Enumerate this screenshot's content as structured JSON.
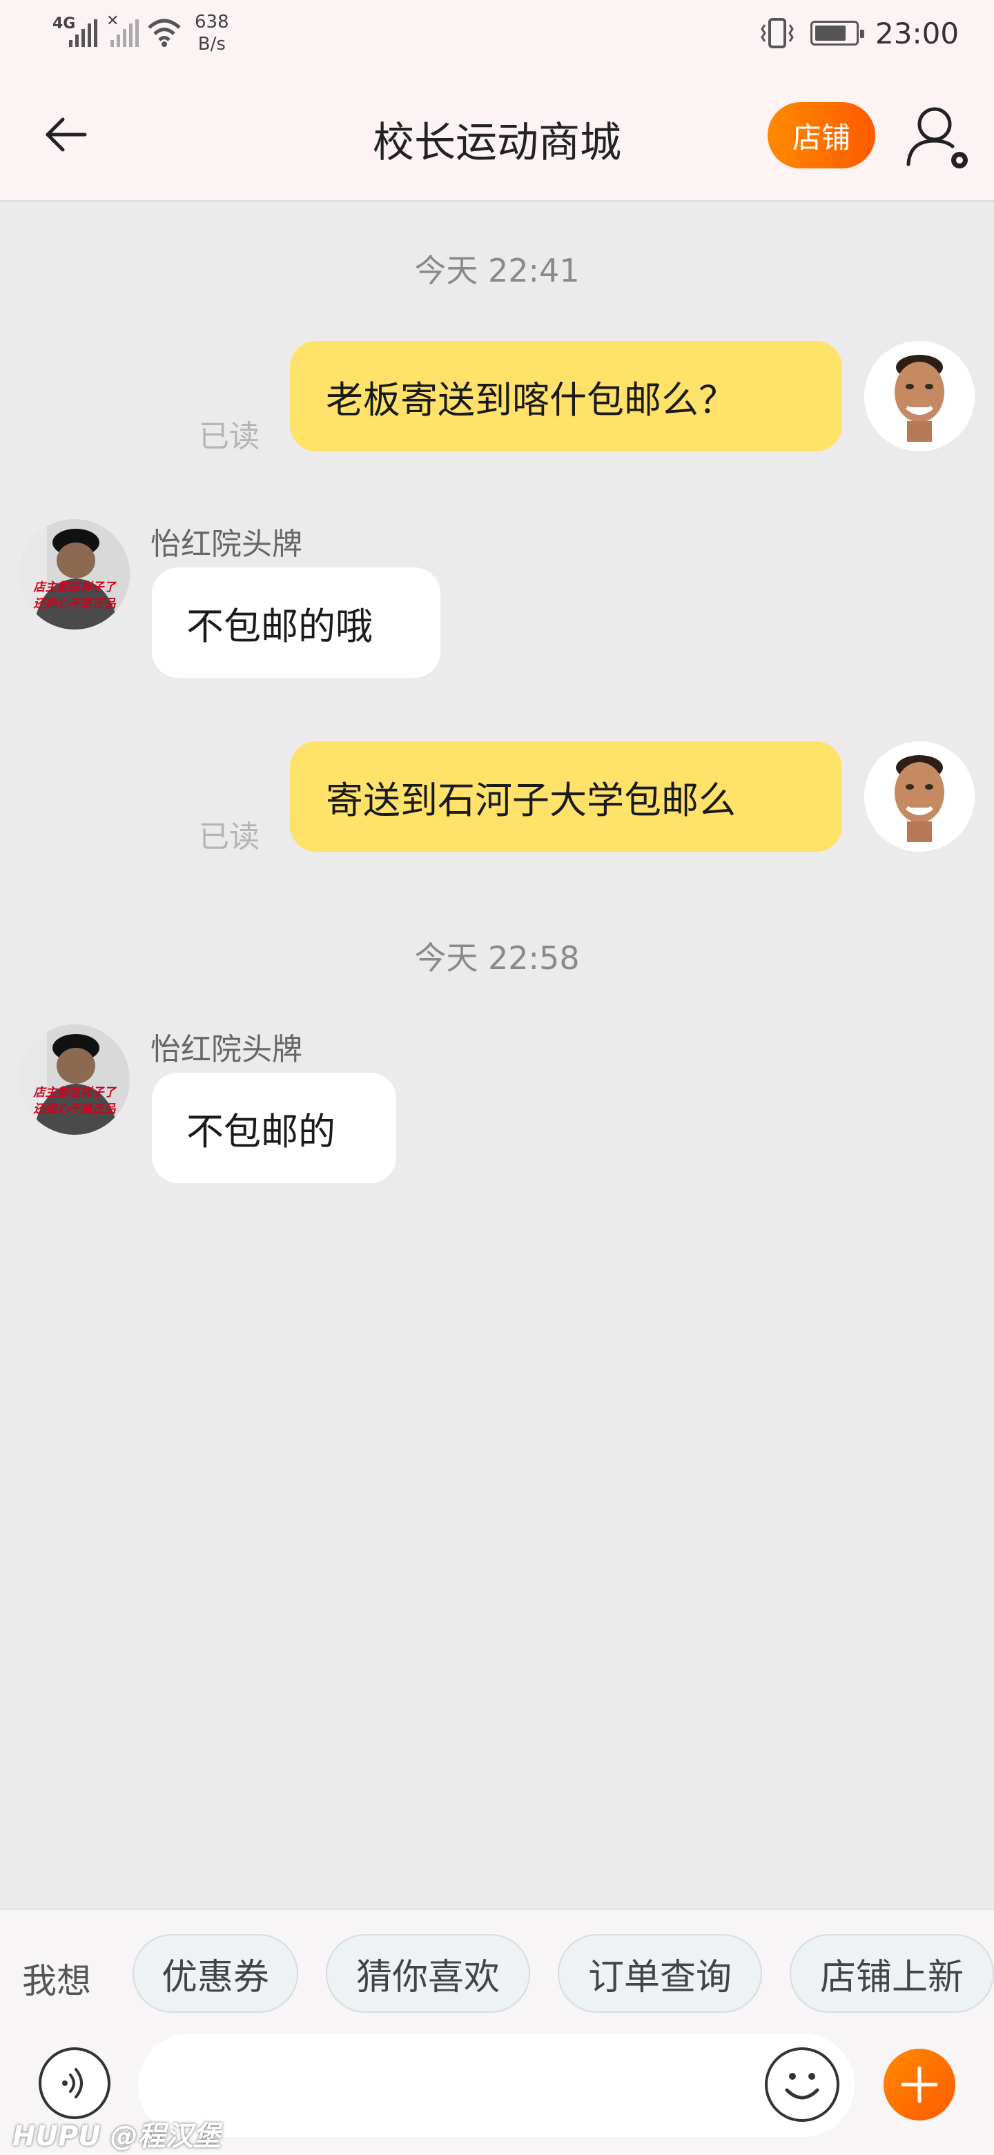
{
  "status_bar": {
    "network_label": "4G",
    "speed_value": "638",
    "speed_unit": "B/s",
    "time": "23:00",
    "battery_level": 0.75,
    "icons": [
      "cellular-signal-icon",
      "no-signal-icon",
      "wifi-icon",
      "vibrate-icon",
      "battery-icon"
    ]
  },
  "header": {
    "title": "校长运动商城",
    "shop_button": "店铺",
    "back_icon": "back-arrow-icon",
    "user_icon": "user-settings-icon"
  },
  "chat": {
    "messages": [
      {
        "type": "timestamp",
        "text": "今天  22:41"
      },
      {
        "type": "outgoing",
        "text": "老板寄送到喀什包邮么？",
        "status": "已读"
      },
      {
        "type": "incoming",
        "sender": "怡红院头牌",
        "text": "不包邮的哦"
      },
      {
        "type": "outgoing",
        "text": "寄送到石河子大学包邮么",
        "status": "已读"
      },
      {
        "type": "timestamp",
        "text": "今天  22:58"
      },
      {
        "type": "incoming",
        "sender": "怡红院头牌",
        "text": "不包邮的"
      }
    ]
  },
  "quick_actions": {
    "label": "我想",
    "chips": [
      "优惠券",
      "猜你喜欢",
      "订单查询",
      "店铺上新"
    ]
  },
  "input": {
    "placeholder": "",
    "value": ""
  },
  "watermark": "HUPU @程汉堡",
  "colors": {
    "accent": "#ff6a00",
    "outgoing_bubble": "#ffe26a",
    "incoming_bubble": "#ffffff",
    "chat_background": "#ebebeb",
    "header_background": "#fcf3f4"
  }
}
